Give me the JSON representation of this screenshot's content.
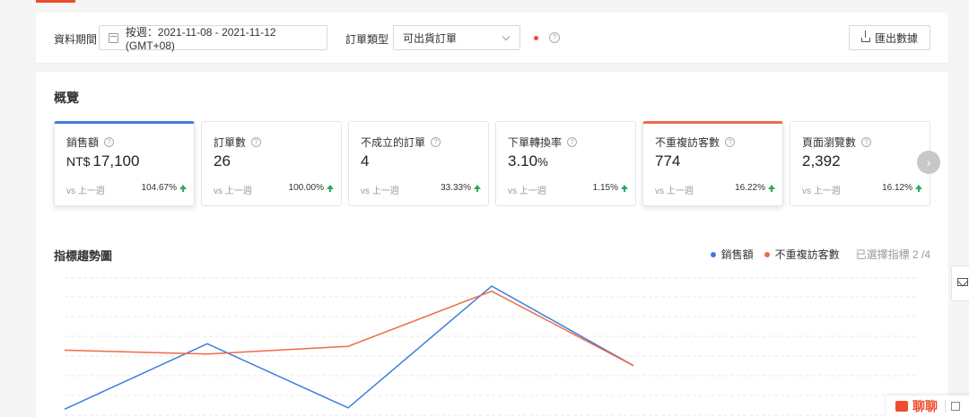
{
  "filter": {
    "period_label": "資料期間",
    "date_range": "按週：2021-11-08 - 2021-11-12 (GMT+08)",
    "order_type_label": "訂單類型",
    "order_type_value": "可出貨訂單",
    "help": "?",
    "export_label": "匯出數據"
  },
  "overview": {
    "title": "概覽",
    "vs_label": "vs 上一週",
    "help": "?",
    "next": "›",
    "cards": [
      {
        "title": "銷售額",
        "unit": "NT$",
        "value": "17,100",
        "suffix": "",
        "change": "104.67%"
      },
      {
        "title": "訂單數",
        "unit": "",
        "value": "26",
        "suffix": "",
        "change": "100.00%"
      },
      {
        "title": "不成立的訂單",
        "unit": "",
        "value": "4",
        "suffix": "",
        "change": "33.33%"
      },
      {
        "title": "下單轉換率",
        "unit": "",
        "value": "3.10",
        "suffix": "%",
        "change": "1.15%"
      },
      {
        "title": "不重複訪客數",
        "unit": "",
        "value": "774",
        "suffix": "",
        "change": "16.22%"
      },
      {
        "title": "頁面瀏覽數",
        "unit": "",
        "value": "2,392",
        "suffix": "",
        "change": "16.12%"
      }
    ]
  },
  "trend": {
    "title": "指標趨勢圖",
    "selected_count": "已選擇指標 2 /4"
  },
  "chart_data": {
    "type": "line",
    "x": [
      0,
      1,
      2,
      3,
      4
    ],
    "series": [
      {
        "name": "銷售額",
        "color": "#3b7ddd",
        "values": [
          0.04,
          0.55,
          0.05,
          1.0,
          0.38
        ]
      },
      {
        "name": "不重複訪客數",
        "color": "#ee6b48",
        "values": [
          0.5,
          0.47,
          0.53,
          0.96,
          0.38
        ]
      }
    ],
    "grid": true
  },
  "chat": {
    "label": "聊聊"
  }
}
